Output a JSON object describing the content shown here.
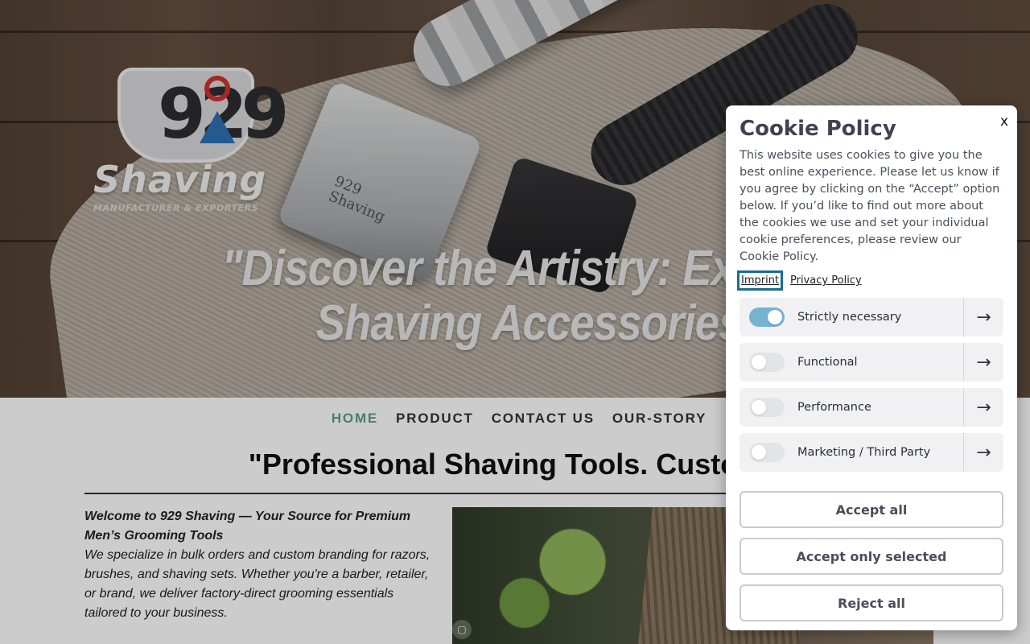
{
  "brand": {
    "logo_number": "929",
    "logo_word": "Shaving",
    "logo_subtitle": "MANUFACTURER & EXPORTERS",
    "engraving_line1": "929",
    "engraving_line2": "Shaving"
  },
  "hero": {
    "tagline_line1": "\"Discover the Artistry: Excep",
    "tagline_line2": "Shaving Accessories"
  },
  "nav": {
    "items": [
      "HOME",
      "PRODUCT",
      "CONTACT US",
      "OUR-STORY"
    ],
    "active": "HOME",
    "active_color": "#5f9e86"
  },
  "main": {
    "heading": "\"Professional Shaving Tools. Custom-M",
    "intro_title": "Welcome to 929 Shaving — Your Source for Premium Men’s Grooming Tools",
    "intro_body": "We specialize in bulk orders and custom branding for razors, brushes, and shaving sets. Whether you're a barber, retailer, or brand, we deliver factory-direct grooming essentials tailored to your business.",
    "slider_icon": "image-icon"
  },
  "cookie": {
    "close_label": "x",
    "title": "Cookie Policy",
    "text": "This website uses cookies to give you the best online experience. Please let us know if you agree by clicking on the “Accept” option below. If you’d like to find out more about the cookies we use and set your individual cookie preferences, please review our Cookie Policy.",
    "links": {
      "imprint": "Imprint",
      "privacy": "Privacy Policy"
    },
    "categories": [
      {
        "label": "Strictly necessary",
        "enabled": true
      },
      {
        "label": "Functional",
        "enabled": false
      },
      {
        "label": "Performance",
        "enabled": false
      },
      {
        "label": "Marketing / Third Party",
        "enabled": false
      }
    ],
    "arrow_icon": "arrow-right-icon",
    "toggle_on_color": "#76b3d2",
    "buttons": {
      "accept_all": "Accept all",
      "accept_selected": "Accept only selected",
      "reject_all": "Reject all"
    }
  }
}
